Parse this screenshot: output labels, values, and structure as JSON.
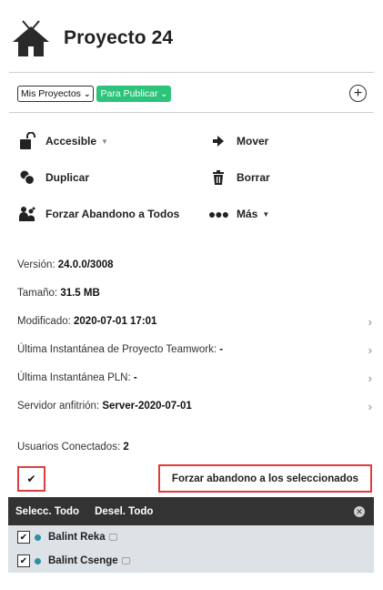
{
  "header": {
    "title": "Proyecto 24",
    "icon": "house-icon"
  },
  "filters": {
    "projects_select": "Mis Proyectos",
    "status_select": "Para Publicar",
    "status_color": "#2bc47a",
    "add_icon": "plus-circle-icon"
  },
  "actions": {
    "accessible": "Accesible",
    "move": "Mover",
    "duplicate": "Duplicar",
    "delete": "Borrar",
    "force_leave_all": "Forzar Abandono a Todos",
    "more": "Más"
  },
  "info": {
    "version_label": "Versión:",
    "version_value": "24.0.0/3008",
    "size_label": "Tamaño:",
    "size_value": "31.5 MB",
    "modified_label": "Modificado:",
    "modified_value": "2020-07-01 17:01",
    "snapshot_teamwork_label": "Última Instantánea de Proyecto Teamwork:",
    "snapshot_teamwork_value": "-",
    "snapshot_pln_label": "Última Instantánea PLN:",
    "snapshot_pln_value": "-",
    "host_label": "Servidor anfitrión:",
    "host_value": "Server-2020-07-01"
  },
  "users": {
    "connected_label": "Usuarios Conectados:",
    "connected_count": "2",
    "force_selected_button": "Forzar abandono a los seleccionados",
    "select_all": "Selecc. Todo",
    "deselect_all": "Desel. Todo",
    "list": [
      {
        "name": "Balint Reka",
        "checked": true
      },
      {
        "name": "Balint Csenge",
        "checked": true
      }
    ],
    "highlight_color": "#e23b3b"
  }
}
